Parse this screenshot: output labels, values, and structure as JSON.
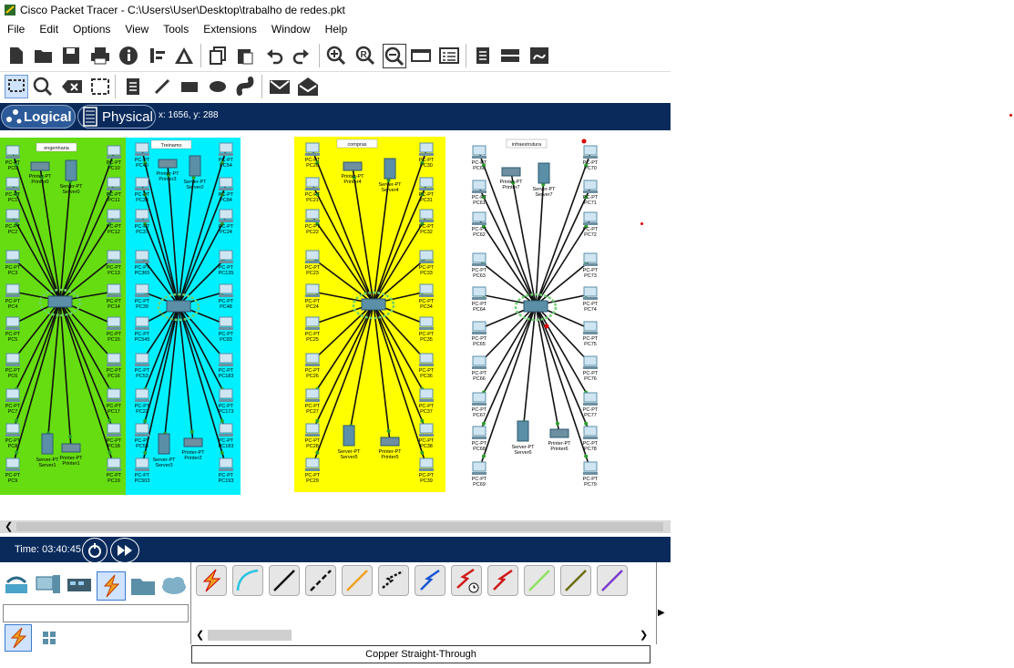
{
  "window": {
    "title": "Cisco Packet Tracer - C:\\Users\\User\\Desktop\\trabalho de redes.pkt"
  },
  "menu": [
    "File",
    "Edit",
    "Options",
    "View",
    "Tools",
    "Extensions",
    "Window",
    "Help"
  ],
  "toolbar1_icons": [
    "new-icon",
    "open-icon",
    "save-icon",
    "print-icon",
    "info-icon",
    "activity-wizard-icon",
    "pdu-icon",
    "copy-icon",
    "paste-icon",
    "undo-icon",
    "redo-icon",
    "zoom-in-icon",
    "zoom-reset-icon",
    "zoom-out-icon",
    "drawing-palette-icon",
    "custom-device-icon",
    "notes-icon",
    "device-list-icon",
    "viewport-icon"
  ],
  "toolbar2_icons": [
    "select-icon",
    "inspect-icon",
    "delete-icon",
    "resize-icon",
    "note-icon",
    "line-icon",
    "rectangle-icon",
    "ellipse-icon",
    "freeform-icon",
    "simple-pdu-icon",
    "complex-pdu-icon"
  ],
  "modes": {
    "logical": "Logical",
    "physical": "Physical"
  },
  "coords": "x: 1656, y: 288",
  "zones": [
    {
      "label": "engenharia",
      "color": "#66dd10"
    },
    {
      "label": "Treinamo",
      "color": "#00f0ff"
    },
    {
      "label": "compras",
      "color": "#ffff00"
    },
    {
      "label": "infraestrutura",
      "color": "#ffffff"
    }
  ],
  "pc_labels": {
    "zone1_left": [
      "PC0",
      "PC1",
      "PC2",
      "PC3",
      "PC4",
      "PC5",
      "PC6",
      "PC7",
      "PC8",
      "PC9"
    ],
    "zone1_right": [
      "PC10",
      "PC11",
      "PC12",
      "PC13",
      "PC14",
      "PC15",
      "PC16",
      "PC17",
      "PC18",
      "PC19"
    ],
    "zone2_left": [
      "PC40",
      "PC38",
      "PC37",
      "PC365",
      "PC39",
      "PC545",
      "PC53",
      "PC22",
      "PC53",
      "PC503"
    ],
    "zone2_right": [
      "PC54",
      "PC84",
      "PC24",
      "PC135",
      "PC48",
      "PC83",
      "PC183",
      "PC173",
      "PC183",
      "PC193"
    ],
    "zone3_left": [
      "PC20",
      "PC21",
      "PC22",
      "PC23",
      "PC24",
      "PC25",
      "PC26",
      "PC27",
      "PC28",
      "PC29"
    ],
    "zone3_right": [
      "PC30",
      "PC31",
      "PC32",
      "PC33",
      "PC34",
      "PC35",
      "PC36",
      "PC37",
      "PC38",
      "PC39"
    ],
    "zone4_left": [
      "PC60",
      "PC61",
      "PC62",
      "PC63",
      "PC64",
      "PC65",
      "PC66",
      "PC67",
      "PC68",
      "PC69"
    ],
    "zone4_right": [
      "PC70",
      "PC71",
      "PC72",
      "PC73",
      "PC74",
      "PC75",
      "PC76",
      "PC77",
      "PC78",
      "PC79"
    ]
  },
  "devices": {
    "z1_printer": "Printer0",
    "z1_server": "Server0",
    "z1_server_b": "Server1",
    "z1_printer_b": "Printer1",
    "z2_printer": "Printer3",
    "z2_server": "Server2",
    "z2_server_b": "Server3",
    "z2_printer_b": "Printer2",
    "z3_printer": "Printer4",
    "z3_server": "Server4",
    "z3_server_b": "Server5",
    "z3_printer_b": "Printer5",
    "z4_printer": "Printer7",
    "z4_server": "Server7",
    "z4_server_b": "Server6",
    "z4_printer_b": "Printer6"
  },
  "time": "Time: 03:40:45",
  "device_categories": [
    "network-devices-icon",
    "end-devices-icon",
    "components-icon",
    "connections-icon",
    "miscellaneous-icon",
    "multiuser-icon"
  ],
  "cable_icons": [
    "automatic-cable-icon",
    "console-cable-icon",
    "copper-straight-icon",
    "copper-cross-icon",
    "fiber-icon",
    "phone-cable-icon",
    "coaxial-icon",
    "serial-dce-icon",
    "serial-dte-icon",
    "octal-cable-icon",
    "iot-custom-cable-icon",
    "usb-cable-icon"
  ],
  "status_label": "Copper Straight-Through",
  "colors": {
    "navy": "#0a2a5c",
    "accent_orange": "#f0a020"
  }
}
